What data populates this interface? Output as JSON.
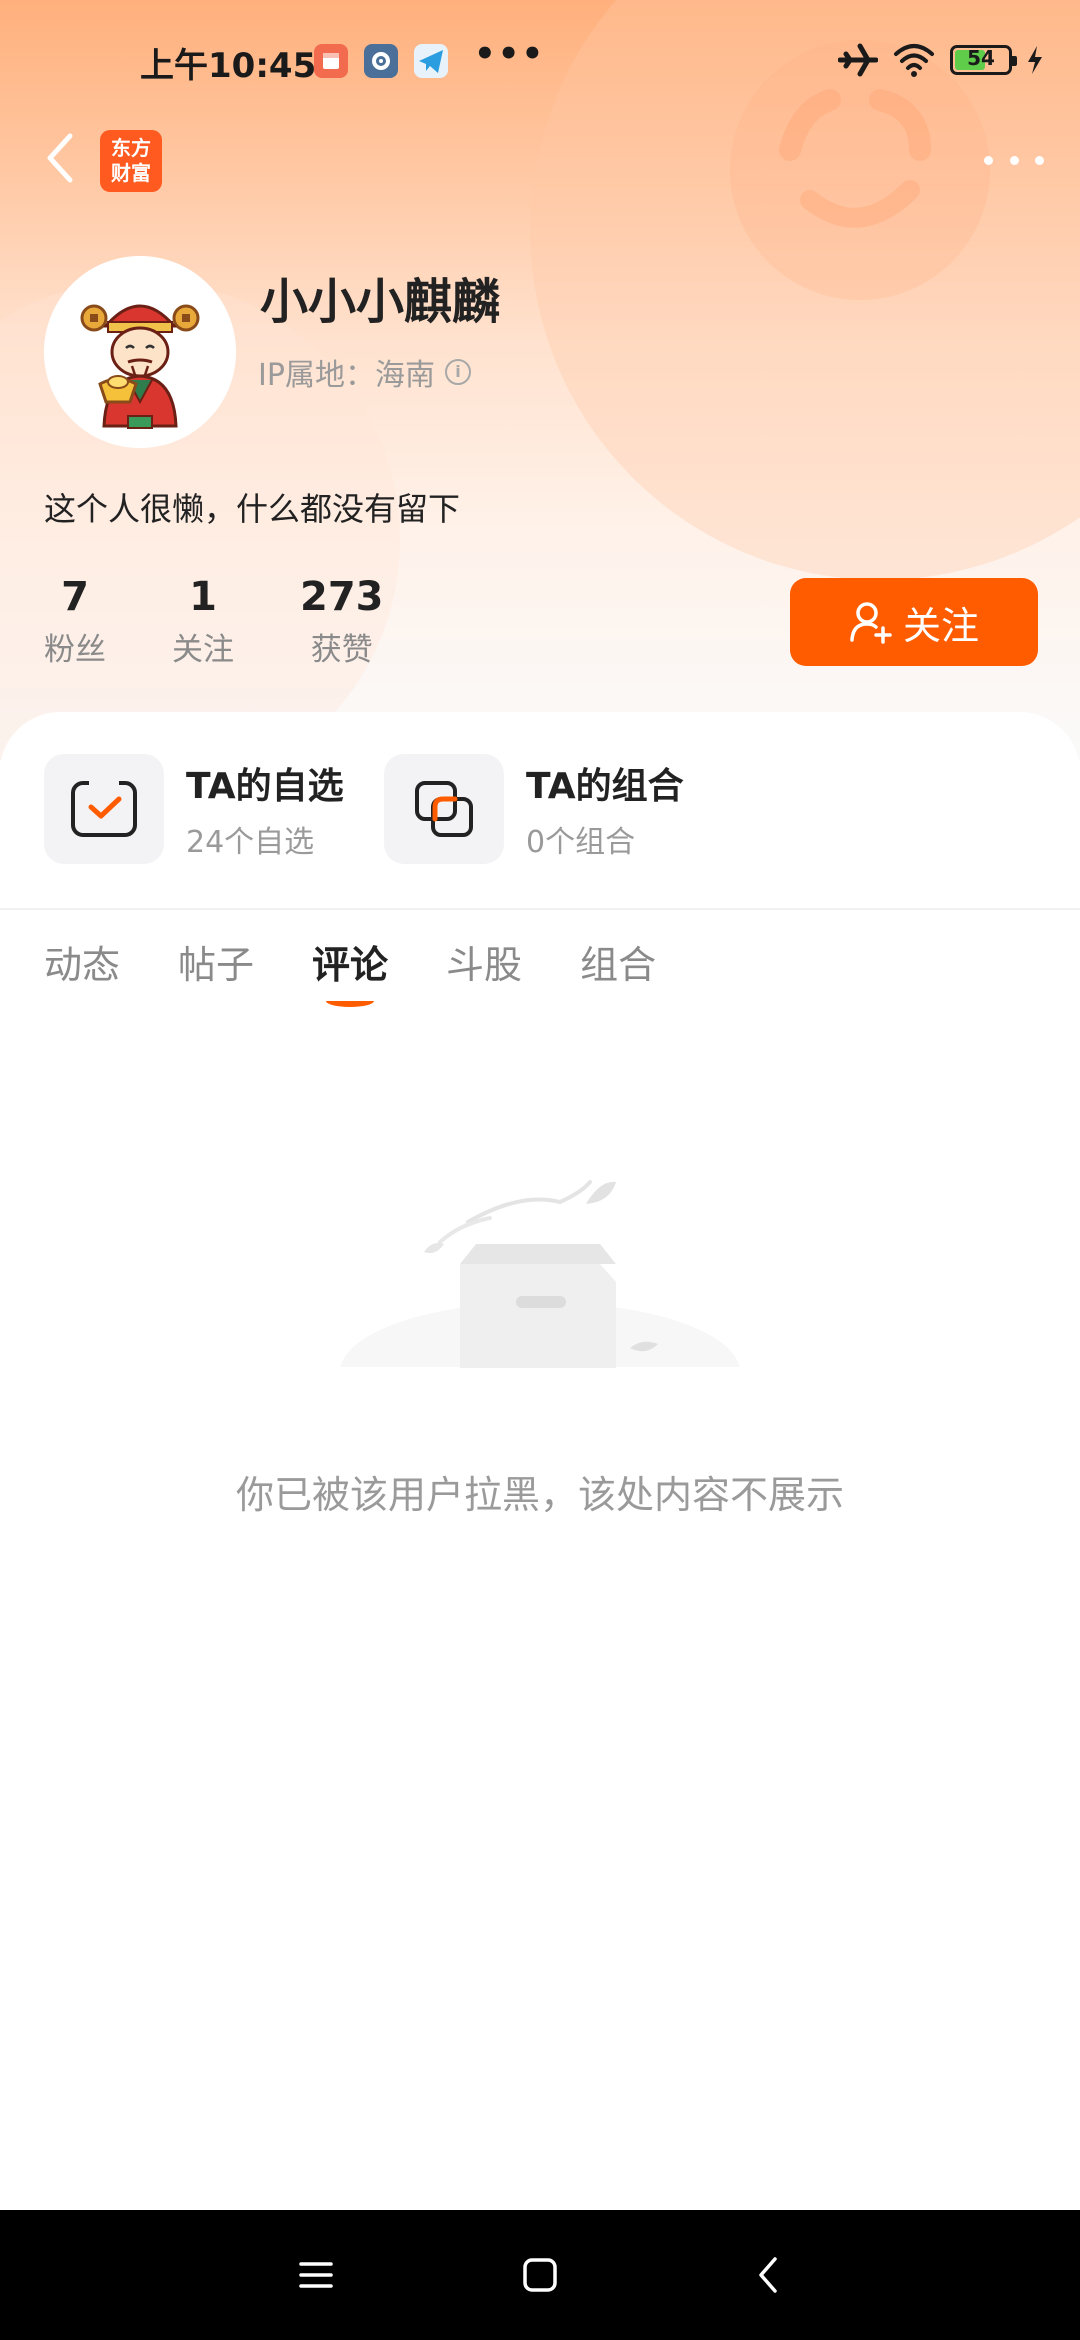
{
  "status_bar": {
    "time": "上午10:45",
    "dots": "•••",
    "battery_level": "54",
    "icons": [
      "calendar-app-icon",
      "settings-app-icon",
      "telegram-app-icon",
      "airplane-icon",
      "wifi-icon",
      "battery-icon",
      "charging-icon"
    ]
  },
  "nav": {
    "logo_text": "东方财富",
    "icons": [
      "back-arrow-icon",
      "more-dots-icon"
    ]
  },
  "profile": {
    "username": "小小小麒麟",
    "ip_location": "IP属地：海南",
    "bio": "这个人很懒，什么都没有留下"
  },
  "stats": [
    {
      "value": "7",
      "label": "粉丝"
    },
    {
      "value": "1",
      "label": "关注"
    },
    {
      "value": "273",
      "label": "获赞"
    }
  ],
  "follow_button": {
    "label": "关注",
    "color": "#ff5c00"
  },
  "features": [
    {
      "title": "TA的自选",
      "subtitle": "24个自选"
    },
    {
      "title": "TA的组合",
      "subtitle": "0个组合"
    }
  ],
  "tabs": [
    {
      "label": "动态",
      "active": false
    },
    {
      "label": "帖子",
      "active": false
    },
    {
      "label": "评论",
      "active": true
    },
    {
      "label": "斗股",
      "active": false
    },
    {
      "label": "组合",
      "active": false
    }
  ],
  "empty_state": {
    "message": "你已被该用户拉黑，该处内容不展示"
  },
  "colors": {
    "accent": "#ff5c00",
    "header_gradient_top": "#ffb07c",
    "system_nav": "#000000"
  }
}
